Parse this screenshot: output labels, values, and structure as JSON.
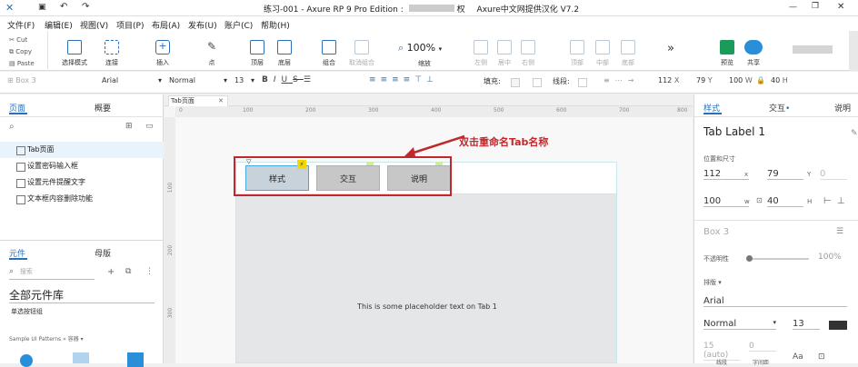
{
  "window": {
    "title": "练习-001 - Axure RP 9 Pro Edition : ",
    "title_suffix": "权",
    "title_brand": "Axure中文网提供汉化 V7.2"
  },
  "menu": [
    "文件(F)",
    "编辑(E)",
    "视图(V)",
    "项目(P)",
    "布局(A)",
    "发布(U)",
    "账户(C)",
    "帮助(H)"
  ],
  "clipboard": {
    "cut": "Cut",
    "copy": "Copy",
    "paste": "Paste"
  },
  "toolbar": {
    "select_mode": "选择模式",
    "connect": "连接",
    "insert": "插入",
    "point": "点",
    "top": "顶层",
    "bottom": "底层",
    "group": "组合",
    "ungroup": "取消组合",
    "zoom": "100%",
    "zoom_label": "缩放",
    "left": "左侧",
    "center": "居中",
    "right": "右侧",
    "top2": "顶部",
    "middle": "中部",
    "bottom2": "底部",
    "more": "»",
    "preview": "预览",
    "share": "共享"
  },
  "format": {
    "widget_name": "Box 3",
    "font": "Arial",
    "style": "Normal",
    "size": "13",
    "fill_label": "填充:",
    "line_label": "线段:",
    "x": "112",
    "x_label": "X",
    "y": "79",
    "y_label": "Y",
    "w": "100",
    "w_label": "W",
    "h": "40",
    "h_label": "H"
  },
  "left_panel": {
    "tab_pages": "页面",
    "tab_outline": "概要",
    "pages": [
      "Tab页面",
      "设置密码输入框",
      "设置元件提醒文字",
      "文本框内容删除功能"
    ],
    "tab_widgets": "元件",
    "tab_masters": "母版",
    "search_placeholder": "搜索",
    "library": "全部元件库",
    "library_sub": "单选按钮组",
    "patterns": "Sample UI Patterns » 容器 ▾"
  },
  "canvas": {
    "doc_tab": "Tab页面",
    "ruler_top": [
      "0",
      "100",
      "200",
      "300",
      "400",
      "500",
      "600",
      "700",
      "800"
    ],
    "ruler_left": [
      "100",
      "200",
      "300"
    ],
    "tabs": [
      "样式",
      "交互",
      "说明"
    ],
    "placeholder": "This is some placeholder text on Tab 1",
    "annotation": "双击重命名Tab名称",
    "accent": "#c0282d"
  },
  "right_panel": {
    "tab_style": "样式",
    "tab_interact": "交互",
    "tab_notes": "说明",
    "label": "Tab Label 1",
    "pos_size": "位置和尺寸",
    "x": "112",
    "x_lbl": "x",
    "y": "79",
    "y_lbl": "Y",
    "r": "0",
    "w": "100",
    "w_lbl": "w",
    "h": "40",
    "h_lbl": "H",
    "box": "Box 3",
    "opacity_label": "不透明性",
    "opacity": "100%",
    "type_label": "排版",
    "font": "Arial",
    "style": "Normal",
    "size": "13",
    "line_height": "15 (auto)",
    "spacing": "0",
    "aa": "Aa",
    "line_lbl": "线段",
    "char_lbl": "字间距"
  },
  "colors": {
    "accent_blue": "#2a6fb8",
    "annotation_red": "#c0282d",
    "tab_bg": "#c7c7c7"
  }
}
